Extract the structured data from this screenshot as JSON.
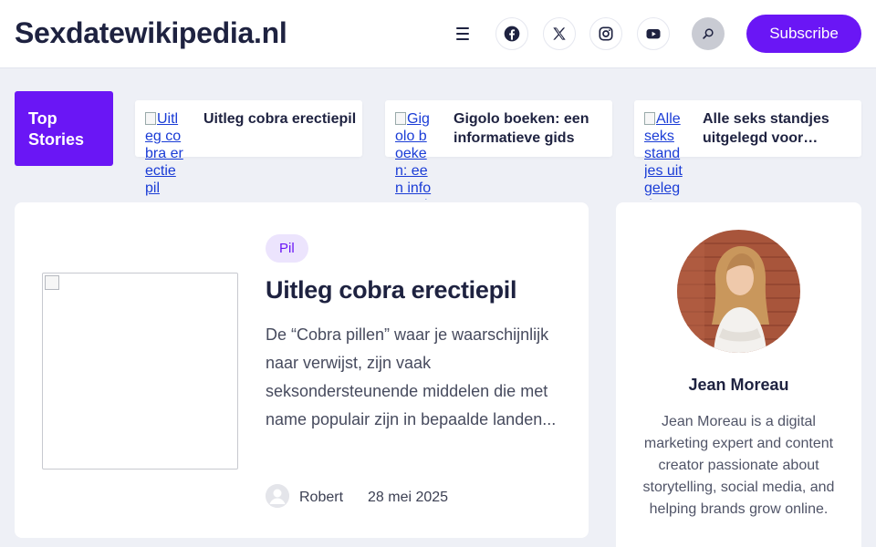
{
  "site": {
    "logo": "Sexdatewikipedia.nl",
    "subscribe_label": "Subscribe"
  },
  "header_icons": [
    "menu-icon",
    "facebook-icon",
    "x-icon",
    "instagram-icon",
    "youtube-icon",
    "search-icon"
  ],
  "top_stories": {
    "label": "Top Stories",
    "items": [
      {
        "title": "Uitleg cobra erectiepil",
        "image_alt": "Uitleg cobra erectiepil"
      },
      {
        "title": "Gigolo boeken: een informatieve gids",
        "image_alt": "Gigolo boeken: een informatieve gids"
      },
      {
        "title": "Alle seks standjes uitgelegd voor…",
        "image_alt": "Alle seks standjes uitgelegd voor"
      }
    ]
  },
  "featured_post": {
    "category": "Pil",
    "title": "Uitleg cobra erectiepil",
    "excerpt": "De “Cobra pillen” waar je waarschijnlijk naar verwijst, zijn vaak seksondersteunende middelen die met name populair zijn in bepaalde landen...",
    "author": "Robert",
    "date": "28 mei 2025"
  },
  "author_box": {
    "name": "Jean Moreau",
    "bio": "Jean Moreau is a digital marketing expert and content creator passionate about storytelling, social media, and helping brands grow online."
  },
  "colors": {
    "accent": "#6a16f5",
    "background": "#eef0f6",
    "text": "#1e2240"
  }
}
